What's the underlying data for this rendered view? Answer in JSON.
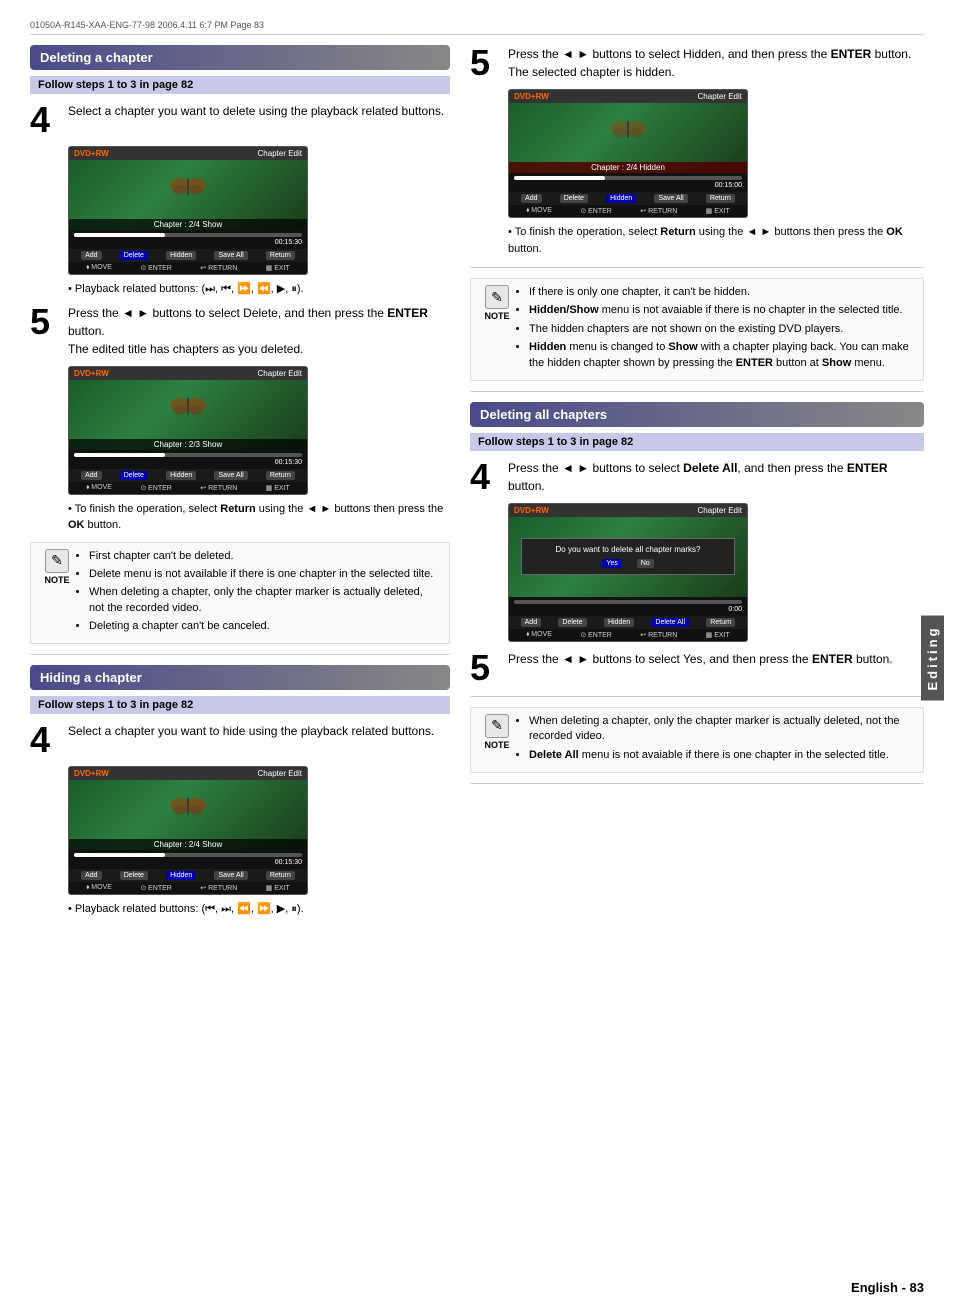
{
  "topbar": {
    "left": "01050A-R145-XAA-ENG-77-98   2006.4.11   6:7 PM   Page 83",
    "right": ""
  },
  "left_column": {
    "section1": {
      "title": "Deleting a chapter",
      "follow": "Follow steps 1 to 3 in page 82",
      "step4": {
        "number": "4",
        "text": "Select a chapter you want to delete using the playback related buttons."
      },
      "screen1": {
        "logo": "DVD+RW",
        "label": "Chapter Edit",
        "chapter_text": "Chapter : 2/4 Show",
        "time": "00:15:30",
        "buttons": [
          "Add",
          "Delete",
          "Hidden",
          "Save All",
          "Return"
        ],
        "nav": [
          "MOVE",
          "ENTER",
          "RETURN",
          "EXIT"
        ]
      },
      "bullet1": "Playback related buttons: (⏭, ⏮, ⏩, ⏪, ▶, ⏸).",
      "step5_title": "5",
      "step5_text1": "Press the ◄ ► buttons to select Delete, and then press the",
      "step5_bold1": "ENTER",
      "step5_text2": "button.",
      "step5_sub": "The edited title has chapters as you deleted.",
      "screen2": {
        "logo": "DVD+RW",
        "label": "Chapter Edit",
        "chapter_text": "Chapter : 2/3 Show",
        "time": "00:15:30",
        "buttons": [
          "Add",
          "Delete",
          "Hidden",
          "Save All",
          "Return"
        ],
        "nav": [
          "MOVE",
          "ENTER",
          "RETURN",
          "EXIT"
        ]
      },
      "bullet2_prefix": "• To finish the operation, select ",
      "bullet2_bold": "Return",
      "bullet2_suffix": " using the ◄ ► buttons then press the ",
      "bullet2_bold2": "OK",
      "bullet2_end": " button.",
      "note1": {
        "items": [
          "First chapter can't be deleted.",
          "Delete menu is not available if there is one chapter in the selected tilte.",
          "When deleting a chapter, only the chapter marker is actually deleted, not the recorded video.",
          "Deleting a chapter can't be canceled."
        ]
      }
    },
    "section2": {
      "title": "Hiding a chapter",
      "follow": "Follow steps 1 to 3 in page 82",
      "step4": {
        "number": "4",
        "text": "Select a chapter you want to hide using the playback related buttons."
      },
      "screen3": {
        "logo": "DVD+RW",
        "label": "Chapter Edit",
        "chapter_text": "Chapter : 2/4 Show",
        "time": "00:15:30",
        "buttons": [
          "Add",
          "Delete",
          "Hidden",
          "Save All",
          "Return"
        ],
        "nav": [
          "MOVE",
          "ENTER",
          "RETURN",
          "EXIT"
        ]
      },
      "bullet3": "Playback related buttons: (⏮, ⏭, ⏪, ⏩, ▶, ⏸)."
    }
  },
  "right_column": {
    "step5_right": {
      "number": "5",
      "text1": "Press the ◄ ► buttons to select Hidden, and then press the",
      "bold1": "ENTER",
      "text2": "button.",
      "sub": "The selected chapter is hidden."
    },
    "screen4": {
      "logo": "DVD+RW",
      "label": "Chapter Edit",
      "chapter_text": "Chapter : 2/4 Hidden",
      "time": "00:15:00",
      "buttons": [
        "Add",
        "Delete",
        "Hidden",
        "Save All",
        "Return"
      ],
      "nav": [
        "MOVE",
        "ENTER",
        "RETURN",
        "EXIT"
      ]
    },
    "bullet4_prefix": "• To finish the operation, select ",
    "bullet4_bold": "Return",
    "bullet4_suffix": " using the ◄ ► buttons then press the ",
    "bullet4_bold2": "OK",
    "bullet4_end": " button.",
    "note2": {
      "items": [
        "If there is only one chapter, it can't be hidden.",
        "Hidden/Show menu is not avaiable if there is no chapter in the selected title.",
        "The hidden chapters are not shown on the existing DVD players.",
        "Hidden menu is changed to Show with a chapter playing back. You can make the hidden chapter shown by pressing the ENTER button at Show menu."
      ],
      "bold_words": [
        "Hidden/Show",
        "Hidden",
        "Show",
        "ENTER",
        "Show"
      ]
    },
    "section3": {
      "title": "Deleting all chapters",
      "follow": "Follow steps 1 to 3 in page 82",
      "step4": {
        "number": "4",
        "text1": "Press the ◄ ► buttons to select",
        "bold1": "Delete All",
        "text2": ", and then press the",
        "bold2": "ENTER",
        "text3": "button."
      },
      "screen5": {
        "logo": "DVD+RW",
        "label": "Chapter Edit",
        "dialog": "Do you want to delete all chapter marks?",
        "yes": "Yes",
        "no": "No",
        "time": "0:00",
        "buttons": [
          "Add",
          "Delete",
          "Hidden",
          "Delete All",
          "Return"
        ],
        "nav": [
          "MOVE",
          "ENTER",
          "RETURN",
          "EXIT"
        ]
      },
      "step5": {
        "number": "5",
        "text1": "Press the ◄ ► buttons to select Yes, and then press the",
        "bold1": "ENTER",
        "text2": "button."
      },
      "note3": {
        "items": [
          "When deleting a chapter, only the chapter marker is actually deleted, not the recorded video.",
          "Delete All menu is not avaiable if there is one chapter in the selected title."
        ],
        "bold_words": [
          "Delete All"
        ]
      }
    },
    "page_number": "English - 83",
    "editing_label": "Editing"
  }
}
